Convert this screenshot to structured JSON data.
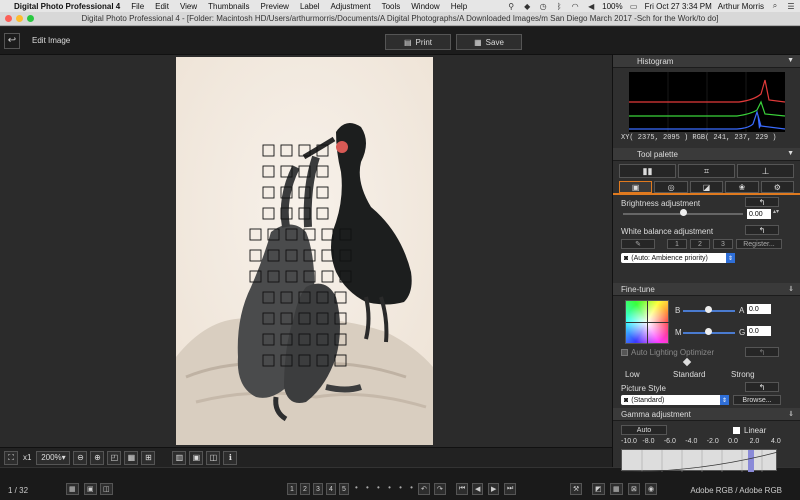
{
  "menubar": {
    "app_name": "Digital Photo Professional 4",
    "items": [
      "File",
      "Edit",
      "View",
      "Thumbnails",
      "Preview",
      "Label",
      "Adjustment",
      "Tools",
      "Window",
      "Help"
    ],
    "battery": "100%",
    "clock": "Fri Oct 27  3:34 PM",
    "user": "Arthur Morris"
  },
  "window": {
    "title": "Digital Photo Professional 4 - [Folder: Macintosh HD/Users/arthurmorris/Documents/A Digital Photographs/A Downloaded Images/m San Diego March 2017 -Sch for the Work/to do]"
  },
  "toolbar": {
    "mode_label": "Edit Image",
    "print_label": "Print",
    "save_label": "Save"
  },
  "bottombar": {
    "zoom_x1": "x1",
    "zoom_value": "200%"
  },
  "status": {
    "image_count": "1 / 32",
    "color_space": "Adobe RGB / Adobe RGB",
    "rating_labels": [
      "1",
      "2",
      "3",
      "4",
      "5"
    ]
  },
  "histogram": {
    "title": "Histogram",
    "readout": "XY(  2375,   2095 ) RGB( 241, 237, 229 )"
  },
  "tool_palette": {
    "title": "Tool palette",
    "brightness_label": "Brightness adjustment",
    "brightness_value": "0.00",
    "brightness_level": 0.5,
    "white_balance_label": "White balance adjustment",
    "wb_buttons": [
      "1",
      "2",
      "3"
    ],
    "register_label": "Register...",
    "wb_mode": "(Auto: Ambience priority)"
  },
  "fine_tune": {
    "title": "Fine-tune",
    "b_label": "B",
    "a_label": "A",
    "m_label": "M",
    "g_label": "G",
    "ba_value": "0.0",
    "mg_value": "0.0",
    "alo_label": "Auto Lighting Optimizer",
    "alo_low": "Low",
    "alo_standard": "Standard",
    "alo_strong": "Strong",
    "picture_style_label": "Picture Style",
    "picture_style_value": "(Standard)",
    "browse_label": "Browse..."
  },
  "gamma": {
    "title": "Gamma adjustment",
    "auto_label": "Auto",
    "linear_label": "Linear",
    "scale": [
      "-10.0",
      "-8.0",
      "-6.0",
      "-4.0",
      "-2.0",
      "0.0",
      "2.0",
      "4.0"
    ]
  },
  "colors": {
    "accent": "#e07a1f",
    "select_blue": "#2f6fd8"
  }
}
